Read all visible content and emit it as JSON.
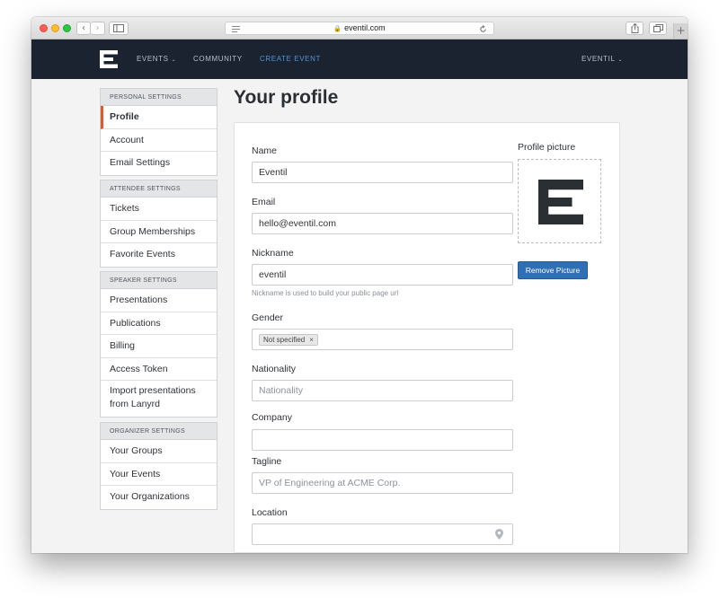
{
  "browser": {
    "url": "eventil.com",
    "buttons": {
      "back": "‹",
      "forward": "›",
      "new_tab": "+"
    }
  },
  "navbar": {
    "items": [
      {
        "label": "EVENTS",
        "has_dropdown": true
      },
      {
        "label": "COMMUNITY",
        "has_dropdown": false
      },
      {
        "label": "CREATE EVENT",
        "has_dropdown": false,
        "color": "#4f95d6"
      }
    ],
    "user": "EVENTIL",
    "background": "#1c2330"
  },
  "sidebar": {
    "groups": [
      {
        "header": "PERSONAL SETTINGS",
        "items": [
          "Profile",
          "Account",
          "Email Settings"
        ],
        "active": "Profile"
      },
      {
        "header": "ATTENDEE SETTINGS",
        "items": [
          "Tickets",
          "Group Memberships",
          "Favorite Events"
        ]
      },
      {
        "header": "SPEAKER SETTINGS",
        "items": [
          "Presentations",
          "Publications",
          "Billing",
          "Access Token",
          "Import presentations from Lanyrd"
        ]
      },
      {
        "header": "ORGANIZER SETTINGS",
        "items": [
          "Your Groups",
          "Your Events",
          "Your Organizations"
        ]
      }
    ],
    "active_color": "#e05a2a"
  },
  "main": {
    "title": "Your profile",
    "form": {
      "name": {
        "label": "Name",
        "value": "Eventil"
      },
      "email": {
        "label": "Email",
        "value": "hello@eventil.com"
      },
      "nickname": {
        "label": "Nickname",
        "value": "eventil",
        "hint": "Nickname is used to build your public page url"
      },
      "gender": {
        "label": "Gender",
        "selected": "Not specified",
        "remove": "×"
      },
      "nationality": {
        "label": "Nationality",
        "placeholder": "Nationality"
      },
      "company": {
        "label": "Company",
        "value": ""
      },
      "tagline": {
        "label": "Tagline",
        "placeholder": "VP of Engineering at ACME Corp."
      },
      "location": {
        "label": "Location",
        "value": ""
      }
    },
    "profile_picture": {
      "label": "Profile picture",
      "remove_button": "Remove Picture"
    }
  },
  "colors": {
    "primary_button": "#2f6fb6"
  }
}
